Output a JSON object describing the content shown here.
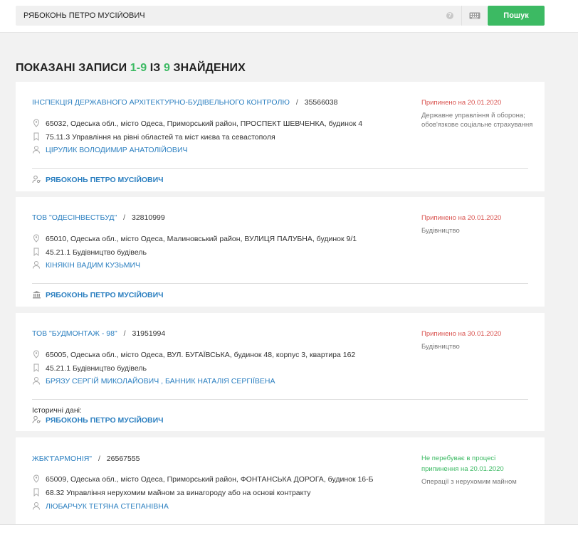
{
  "search": {
    "value": "РЯБОКОНЬ ПЕТРО МУСІЙОВИЧ",
    "button_label": "Пошук"
  },
  "heading": {
    "prefix": "ПОКАЗАНІ ЗАПИСИ ",
    "range": "1-9",
    "middle": " ІЗ ",
    "total": "9",
    "suffix": " ЗНАЙДЕНИХ"
  },
  "records": [
    {
      "name": "ІНСПЕКЦІЯ ДЕРЖАВНОГО АРХІТЕКТУРНО-БУДІВЕЛЬНОГО КОНТРОЛЮ",
      "sep": "/",
      "code": "35566038",
      "status": "Припинено на 20.01.2020",
      "activity": "Державне управління й оборона; обов'язкове соціальне страхування",
      "address": "65032, Одеська обл., місто Одеса, Приморський район, ПРОСПЕКТ ШЕВЧЕНКА, будинок 4",
      "kved": "75.11.3 Управління на рівні областей та міст києва та севастополя",
      "head": "ЦІРУЛИК ВОЛОДИМИР АНАТОЛІЙОВИЧ",
      "person": "РЯБОКОНЬ ПЕТРО МУСІЙОВИЧ",
      "person_icon": "person-key-icon"
    },
    {
      "name": "ТОВ \"ОДЕСІНВЕСТБУД\"",
      "sep": "/",
      "code": "32810999",
      "status": "Припинено на 20.01.2020",
      "activity": "Будівництво",
      "address": "65010, Одеська обл., місто Одеса, Малиновський район, ВУЛИЦЯ ПАЛУБНА, будинок 9/1",
      "kved": "45.21.1 Будівництво будівель",
      "head": "КІНЯКІН ВАДИМ КУЗЬМИЧ",
      "person": "РЯБОКОНЬ ПЕТРО МУСІЙОВИЧ",
      "person_icon": "bank-icon"
    },
    {
      "name": "ТОВ \"БУДМОНТАЖ - 98\"",
      "sep": "/",
      "code": "31951994",
      "status": "Припинено на 30.01.2020",
      "activity": "Будівництво",
      "address": "65005, Одеська обл., місто Одеса, ВУЛ. БУГАЇВСЬКА, будинок 48, корпус 3, квартира 162",
      "kved": "45.21.1 Будівництво будівель",
      "head": "БРЯЗУ СЕРГІЙ МИКОЛАЙОВИЧ , БАННИК НАТАЛІЯ СЕРГІЇВЕНА",
      "history_label": "Історичні дані:",
      "person": "РЯБОКОНЬ ПЕТРО МУСІЙОВИЧ",
      "person_icon": "person-key-icon"
    },
    {
      "name": "ЖБК\"ГАРМОНІЯ\"",
      "sep": "/",
      "code": "26567555",
      "status_line1": "Не перебуває в процесі",
      "status_line2": "припинення на 20.01.2020",
      "activity": "Операції з нерухомим майном",
      "address": "65009, Одеська обл., місто Одеса, Приморський район, ФОНТАНСЬКА ДОРОГА, будинок 16-Б",
      "kved": "68.32 Управління нерухомим майном за винагороду або на основі контракту",
      "head": "ЛЮБАРЧУК ТЕТЯНА СТЕПАНІВНА"
    }
  ],
  "colors": {
    "accent_green": "#3cba63",
    "link_blue": "#2b7fc0",
    "status_red": "#d9534f"
  }
}
